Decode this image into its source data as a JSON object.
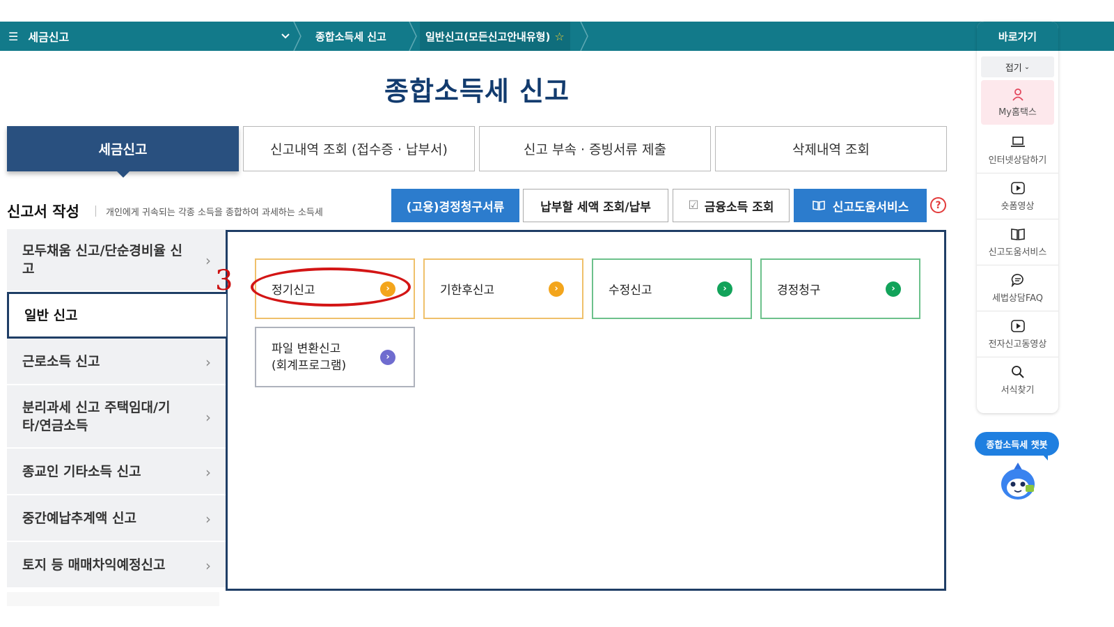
{
  "topbar": {
    "menu_label": "세금신고",
    "breadcrumb": [
      "종합소득세 신고",
      "일반신고(모든신고안내유형)"
    ]
  },
  "page_title": "종합소득세 신고",
  "tabs": [
    {
      "label": "세금신고",
      "active": true
    },
    {
      "label": "신고내역 조회 (접수증 · 납부서)",
      "active": false
    },
    {
      "label": "신고 부속 · 증빙서류 제출",
      "active": false
    },
    {
      "label": "삭제내역 조회",
      "active": false
    }
  ],
  "section": {
    "title": "신고서 작성",
    "description": "개인에게 귀속되는 각종 소득을 종합하여 과세하는 소득세"
  },
  "action_buttons": [
    {
      "label": "(고용)경정청구서류"
    },
    {
      "label": "납부할 세액 조회/납부"
    },
    {
      "label": "금융소득 조회"
    },
    {
      "label": "신고도움서비스"
    }
  ],
  "help_icon": "?",
  "left_menu": [
    {
      "label": "모두채움 신고/단순경비율 신고"
    },
    {
      "label": "일반 신고",
      "active": true
    },
    {
      "label": "근로소득 신고"
    },
    {
      "label": "분리과세 신고 주택임대/기타/연금소득"
    },
    {
      "label": "종교인 기타소득 신고"
    },
    {
      "label": "중간예납추계액 신고"
    },
    {
      "label": "토지 등 매매차익예정신고"
    }
  ],
  "cards": [
    {
      "label": "정기신고",
      "color": "#f3a51c"
    },
    {
      "label": "기한후신고",
      "color": "#f3a51c"
    },
    {
      "label": "수정신고",
      "color": "#12a35a"
    },
    {
      "label": "경정청구",
      "color": "#12a35a"
    },
    {
      "label_line1": "파일 변환신고",
      "label_line2": "(회계프로그램)",
      "color": "#6f6ccf"
    }
  ],
  "quick_links": {
    "title": "바로가기",
    "fold_label": "접기",
    "items": [
      {
        "label": "My홈택스",
        "icon": "person-icon"
      },
      {
        "label": "인터넷상담하기",
        "icon": "laptop-icon"
      },
      {
        "label": "숏폼영상",
        "icon": "play-icon"
      },
      {
        "label": "신고도움서비스",
        "icon": "book-icon"
      },
      {
        "label": "세법상담FAQ",
        "icon": "chat-icon"
      },
      {
        "label": "전자신고동영상",
        "icon": "video-icon"
      },
      {
        "label": "서식찾기",
        "icon": "search-icon"
      }
    ]
  },
  "chatbot": {
    "label": "종합소득세 챗봇"
  },
  "annotation": {
    "number": "3"
  },
  "colors": {
    "teal": "#127a8a",
    "navy": "#29507f",
    "blue_button": "#2c7ccd",
    "annotation_red": "#d31515"
  }
}
